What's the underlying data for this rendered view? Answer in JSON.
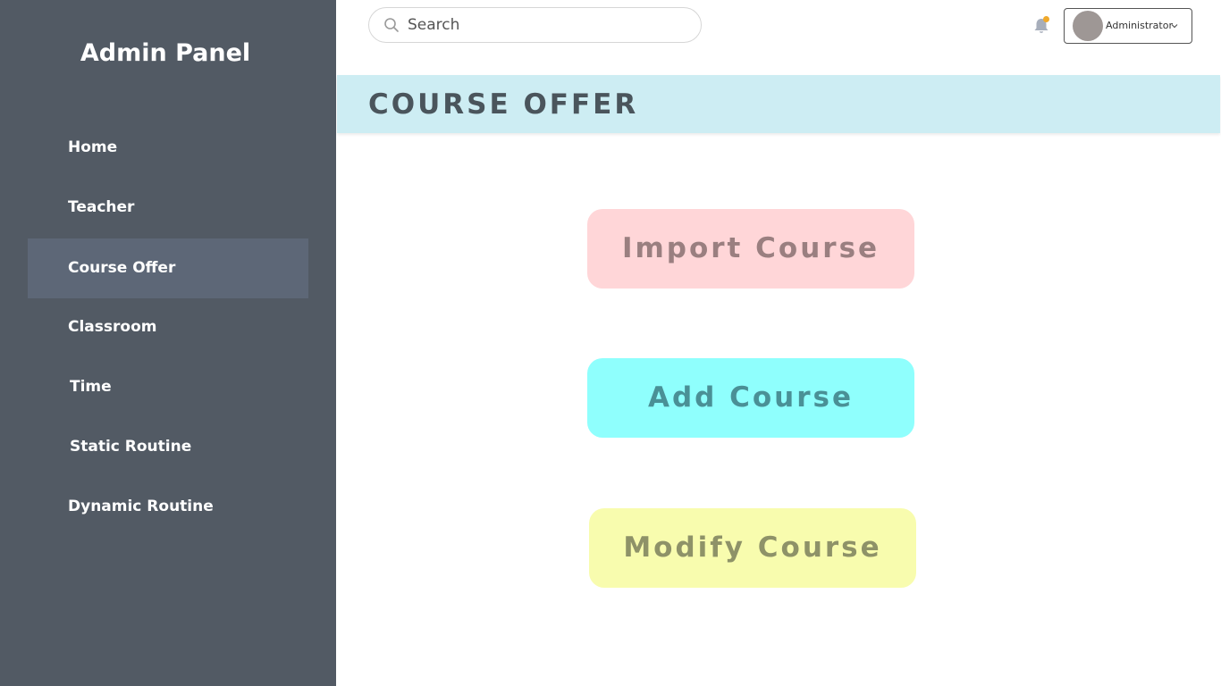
{
  "sidebar": {
    "brand": "Admin Panel",
    "items": [
      {
        "label": "Home"
      },
      {
        "label": "Teacher"
      },
      {
        "label": "Course Offer",
        "active": true
      },
      {
        "label": "Classroom"
      },
      {
        "label": "Time"
      },
      {
        "label": "Static Routine"
      },
      {
        "label": "Dynamic Routine"
      }
    ]
  },
  "header": {
    "search_placeholder": "Search",
    "search_icon": "search-icon",
    "notification_icon": "bell-icon",
    "user": {
      "name": "Administrator",
      "menu_icon": "chevron-down-icon"
    }
  },
  "page": {
    "title": "COURSE OFFER"
  },
  "actions": {
    "import_label": "Import Course",
    "add_label": "Add Course",
    "modify_label": "Modify Course"
  },
  "colors": {
    "sidebar_bg": "#525a64",
    "sidebar_active": "#5d6777",
    "banner_bg": "#cdedf3",
    "import_bg": "#ffd6d8",
    "add_bg": "#8ffffd",
    "modify_bg": "#f8fcae",
    "notification_dot": "#f0a92b"
  }
}
